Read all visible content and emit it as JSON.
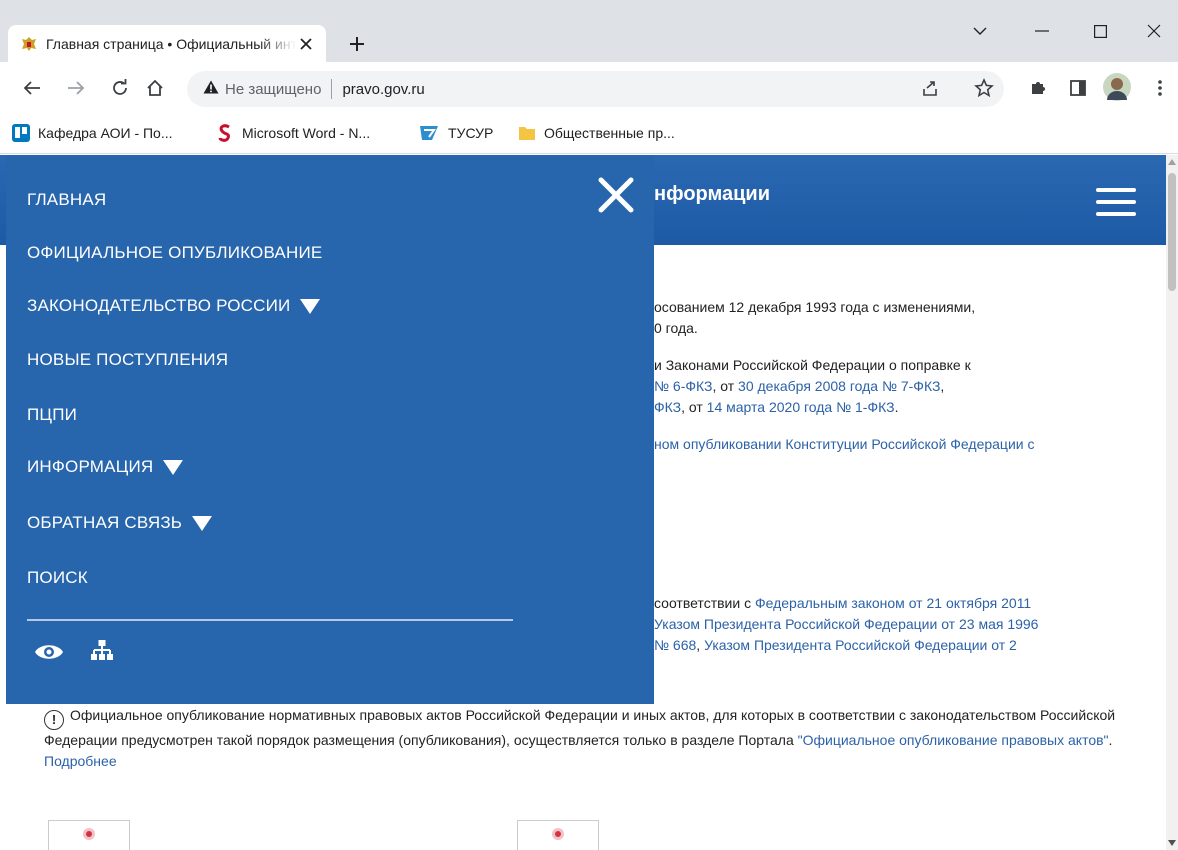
{
  "browser": {
    "tab_title": "Главная страница • Официальный интернет-портал правовой информации",
    "security_label": "Не защищено",
    "url": "pravo.gov.ru",
    "bookmarks": [
      {
        "label": "Кафедра АОИ - По...",
        "icon": "trello-icon",
        "color": "#0079bf"
      },
      {
        "label": "Microsoft Word - N...",
        "icon": "scribd-icon",
        "color": "#c8102e"
      },
      {
        "label": "ТУСУР",
        "icon": "tusur-icon",
        "color": "#2d8ecf"
      },
      {
        "label": "Общественные пр...",
        "icon": "folder-icon",
        "color": "#f4c542"
      }
    ]
  },
  "site": {
    "header_title": "нформации",
    "paragraphs": [
      {
        "line1": "осованием 12 декабря 1993 года с изменениями,",
        "line2": "0 года."
      },
      {
        "line1": "и Законами Российской Федерации о поправке к"
      }
    ],
    "line_links": {
      "a1": "6-ФКЗ",
      "a_sep": ", от ",
      "a2": "30 декабря 2008 года № 7-ФКЗ",
      "a_pre": "№ ",
      "a_end": ",",
      "b1": "ФКЗ",
      "b_sep": ", от ",
      "b2": "14 марта 2020 года № 1-ФКЗ",
      "b_end": ".",
      "c1": "ном опубликовании Конституции Российской Федерации с"
    },
    "para3": {
      "l1_text": "соответствии с ",
      "l1_link": "Федеральным  законом от 21 октября 2011",
      "l2_link": "Указом Президента Российской Федерации от 23 мая 1996",
      "l3_pre": "№ ",
      "l3_link1": "668",
      "l3_sep": ", ",
      "l3_link2": "Указом Президента Российской Федерации от 2"
    },
    "notice": {
      "text1": "Официальное опубликование нормативных правовых актов Российской Федерации и иных актов, для которых в соответствии с законодательством Российской Федерации предусмотрен такой порядок размещения (опубликования), осуществляется только в разделе Портала ",
      "link1": "\"Официальное опубликование правовых актов\"",
      "sep": ". ",
      "link2": "Подробнее"
    }
  },
  "nav": {
    "items": [
      {
        "label": "ГЛАВНАЯ",
        "dropdown": false
      },
      {
        "label": "ОФИЦИАЛЬНОЕ ОПУБЛИКОВАНИЕ",
        "dropdown": false
      },
      {
        "label": "ЗАКОНОДАТЕЛЬСТВО РОССИИ",
        "dropdown": true
      },
      {
        "label": "НОВЫЕ ПОСТУПЛЕНИЯ",
        "dropdown": false
      },
      {
        "label": "ПЦПИ",
        "dropdown": false
      },
      {
        "label": "ИНФОРМАЦИЯ",
        "dropdown": true
      },
      {
        "label": "ОБРАТНАЯ СВЯЗЬ",
        "dropdown": true
      },
      {
        "label": "ПОИСК",
        "dropdown": false
      }
    ],
    "footer_icons": [
      "eye-icon",
      "sitemap-icon"
    ]
  },
  "colors": {
    "brand_blue": "#2765ad",
    "link_blue": "#2c62a8"
  }
}
